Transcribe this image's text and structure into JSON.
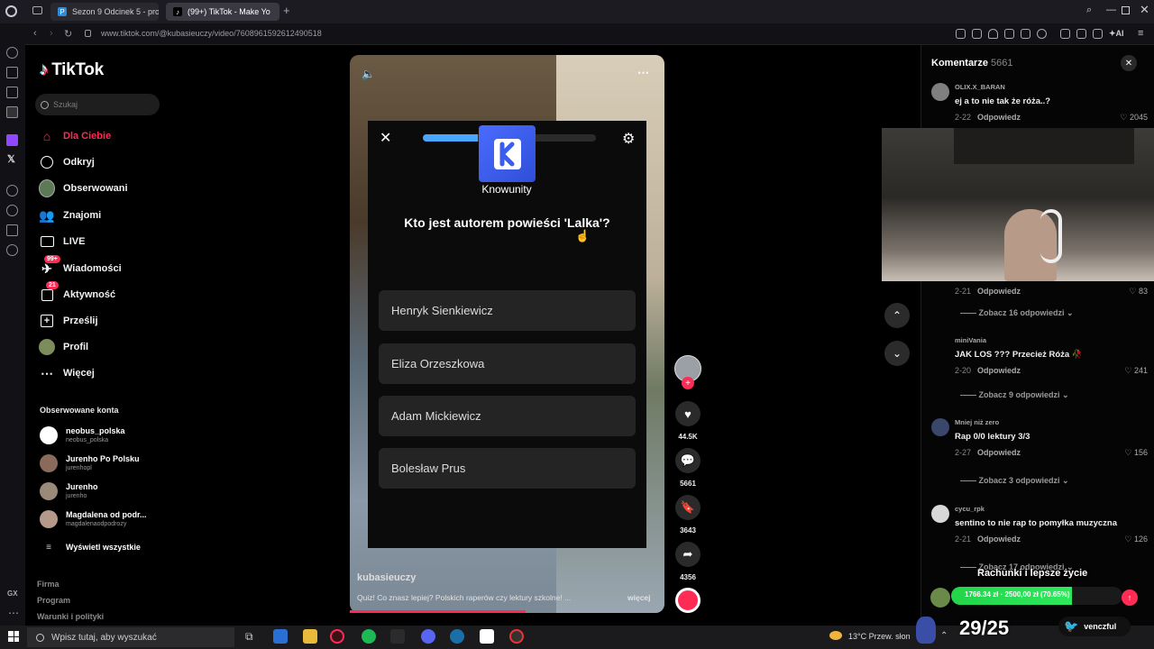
{
  "browser": {
    "tabs": [
      {
        "label": "Sezon 9 Odcinek 5 - prog",
        "active": false
      },
      {
        "label": "(99+) TikTok - Make Yo",
        "active": true
      }
    ],
    "url": "www.tiktok.com/@kubasieuczy/video/7608961592612490518"
  },
  "sidebar": {
    "logo": "TikTok",
    "search_placeholder": "Szukaj",
    "items": [
      {
        "label": "Dla Ciebie",
        "icon": "home-icon",
        "active": true
      },
      {
        "label": "Odkryj",
        "icon": "compass-icon"
      },
      {
        "label": "Obserwowani",
        "icon": "following-avatar"
      },
      {
        "label": "Znajomi",
        "icon": "friends-icon"
      },
      {
        "label": "LIVE",
        "icon": "live-icon"
      },
      {
        "label": "Wiadomości",
        "icon": "messages-icon",
        "badge": "99+"
      },
      {
        "label": "Aktywność",
        "icon": "activity-icon",
        "badge": "21"
      },
      {
        "label": "Prześlij",
        "icon": "upload-icon"
      },
      {
        "label": "Profil",
        "icon": "profile-avatar"
      },
      {
        "label": "Więcej",
        "icon": "more-icon"
      }
    ],
    "followed_title": "Obserwowane konta",
    "followed": [
      {
        "name": "neobus_polska",
        "handle": "neobus_polska"
      },
      {
        "name": "Jurenho Po Polsku",
        "handle": "jurenhopl"
      },
      {
        "name": "Jurenho",
        "handle": "jurenho"
      },
      {
        "name": "Magdalena od podr...",
        "handle": "magdalenaodpodrozy"
      }
    ],
    "show_all": "Wyświetl wszystkie",
    "footer": [
      "Firma",
      "Program",
      "Warunki i polityki"
    ]
  },
  "video": {
    "quiz": {
      "brand": "Knowunity",
      "progress": 0.32,
      "question": "Kto jest autorem powieści 'Lalka'?",
      "answers": [
        "Henryk Sienkiewicz",
        "Eliza Orzeszkowa",
        "Adam Mickiewicz",
        "Bolesław Prus"
      ]
    },
    "author": "kubasieuczy",
    "description": "Quiz! Co znasz lepiej? Polskich raperów czy lektury szkolne! ...",
    "more": "więcej",
    "progress": 0.56,
    "stats": {
      "likes": "44.5K",
      "comments": "5661",
      "saves": "3643",
      "shares": "4356"
    }
  },
  "comments": {
    "title": "Komentarze",
    "count": "5661",
    "items": [
      {
        "user": "OLIX.X_BARAN",
        "text": "ej a to nie tak że róża..?",
        "date": "2-22",
        "reply": "Odpowiedz",
        "likes": "2045"
      },
      {
        "user": "miniVania",
        "text": "JAK LOS ??? Przecież Róża 🥀",
        "date": "2-20",
        "reply": "Odpowiedz",
        "likes": "241"
      },
      {
        "user": "Mniej niż zero",
        "text": "Rap 0/0 lektury 3/3",
        "date": "2-27",
        "reply": "Odpowiedz",
        "likes": "156"
      },
      {
        "user": "cycu_rpk",
        "text": "sentino to nie rap to pomyłka muzyczna",
        "date": "2-21",
        "reply": "Odpowiedz",
        "likes": "126"
      }
    ],
    "hidden_row": {
      "date": "2-21",
      "reply": "Odpowiedz",
      "likes": "83"
    },
    "see_more": [
      "Zobacz 16 odpowiedzi",
      "Zobacz 9 odpowiedzi",
      "Zobacz 3 odpowiedzi",
      "Zobacz 17 odpowiedzi"
    ]
  },
  "stream_overlay": {
    "goal_title": "Rachunki i lepsze życie",
    "goal_text": "1766.34 zł · 2500,00 zł (70.65%)",
    "counter": "29/25",
    "twitter": "venczful"
  },
  "taskbar": {
    "search_placeholder": "Wpisz tutaj, aby wyszukać",
    "weather": "13°C  Przew. słon"
  },
  "colors": {
    "accent": "#fe2c55",
    "quiz_blue": "#4aa7ff",
    "knowunity": "#3a5cf0"
  }
}
